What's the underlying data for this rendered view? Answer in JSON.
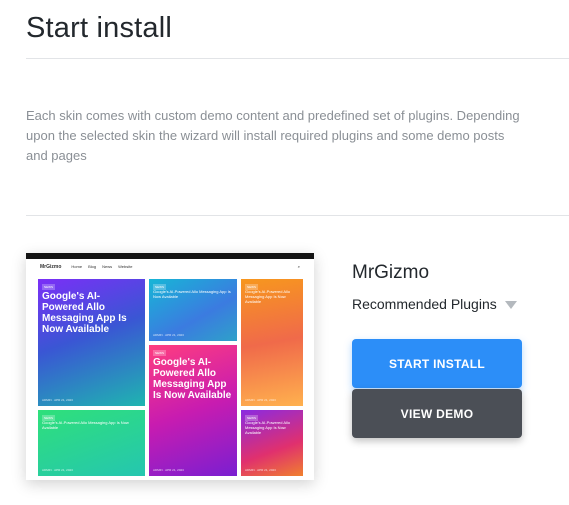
{
  "header": {
    "title": "Start install"
  },
  "intro": {
    "text": "Each skin comes with custom demo content and predefined set of plugins. Depending upon the selected skin the wizard will install required plugins and some demo posts and pages"
  },
  "skin": {
    "name": "MrGizmo",
    "plugins_label": "Recommended Plugins",
    "preview": {
      "logo": "MrGizmo",
      "nav": [
        "Home",
        "Blog",
        "News",
        "Website"
      ],
      "tiles": [
        {
          "tag": "NEWS",
          "headline": "Google's AI-Powered Allo Messaging App Is Now Available",
          "meta": "ADMIN · APR 21, 2023"
        },
        {
          "tag": "NEWS",
          "headline": "Google's AI-Powered Allo Messaging App Is Now Available",
          "meta": "ADMIN · APR 21, 2023"
        },
        {
          "tag": "NEWS",
          "headline": "Google's AI-Powered Allo Messaging App Is Now Available",
          "meta": "ADMIN · APR 21, 2023"
        },
        {
          "tag": "NEWS",
          "headline": "Google's AI-Powered Allo Messaging App Is Now Available",
          "meta": "ADMIN · APR 21, 2023"
        },
        {
          "tag": "NEWS",
          "headline": "Google's AI-Powered Allo Messaging App Is Now Available",
          "meta": "ADMIN · APR 21, 2023"
        },
        {
          "tag": "NEWS",
          "headline": "Google's AI-Powered Allo Messaging App Is Now Available",
          "meta": "ADMIN · APR 21, 2023"
        }
      ]
    }
  },
  "actions": {
    "start_install": "START INSTALL",
    "view_demo": "VIEW DEMO"
  },
  "colors": {
    "primary": "#2c8ef8",
    "secondary": "#4b4f56",
    "text": "#23282d",
    "muted": "#8a8f95"
  },
  "icons": {
    "plugins_toggle": "caret-down-icon"
  }
}
